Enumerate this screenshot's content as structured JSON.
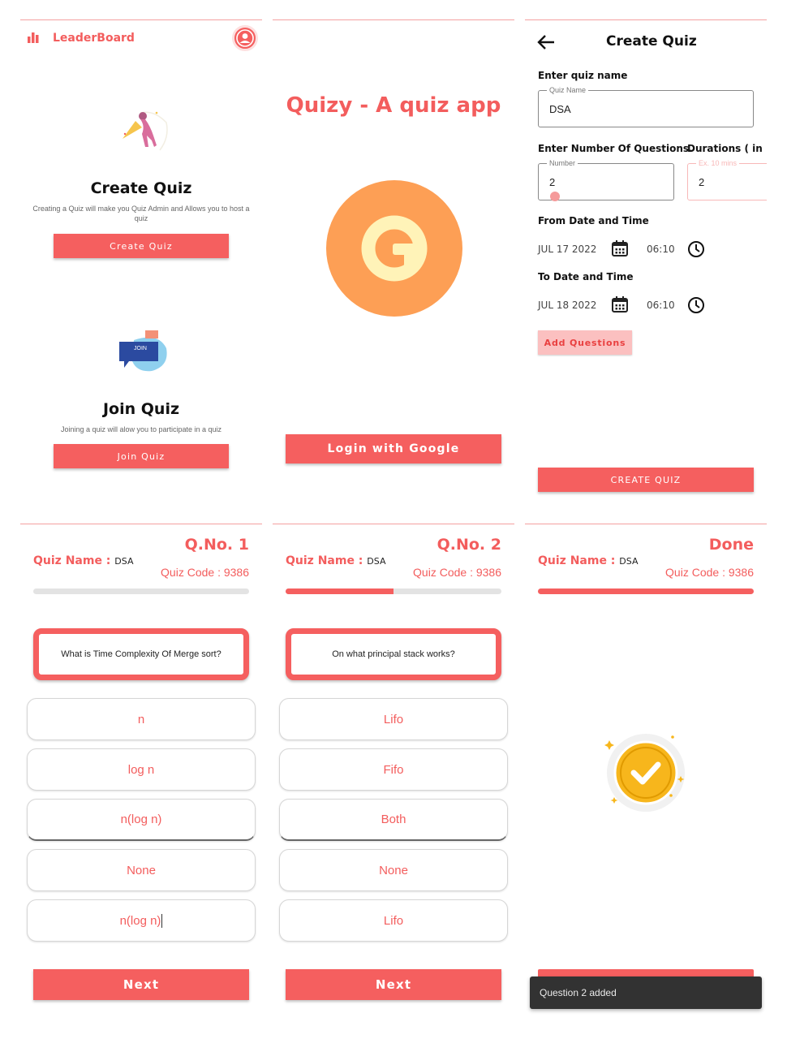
{
  "colors": {
    "accent": "#f55f5f",
    "logo": "#fd9f55",
    "logo_g": "#fff3b8",
    "done": "#f7b61c"
  },
  "home": {
    "leaderboard_label": "LeaderBoard",
    "create_title": "Create Quiz",
    "create_desc": "Creating a Quiz will make you Quiz Admin and Allows you to host a quiz",
    "create_button": "Create Quiz",
    "join_badge": "JOIN",
    "join_title": "Join Quiz",
    "join_desc": "Joining a quiz will alow you to participate in a quiz",
    "join_button": "Join Quiz"
  },
  "login": {
    "app_title": "Quizy - A quiz app",
    "google_button": "Login with Google"
  },
  "create": {
    "title": "Create Quiz",
    "name_label": "Enter quiz name",
    "name_legend": "Quiz Name",
    "name_value": "DSA",
    "num_label": "Enter Number Of Questions.",
    "num_legend": "Number",
    "num_value": "2",
    "dur_label": "Durations ( in mi",
    "dur_legend": "Ex. 10 mins",
    "dur_value": "2",
    "from_label": "From Date and Time",
    "from_date": "JUL 17 2022",
    "from_time": "06:10",
    "to_label": "To Date and Time",
    "to_date": "JUL 18 2022",
    "to_time": "06:10",
    "add_questions": "Add Questions",
    "create_button": "CREATE QUIZ"
  },
  "quiz1": {
    "qno": "Q.No. 1",
    "name_label": "Quiz Name : ",
    "name_value": "DSA",
    "code": "Quiz Code : 9386",
    "progress": 0,
    "question": "What is Time Complexity Of Merge sort?",
    "options": [
      "n",
      "log n",
      "n(log n)",
      "None",
      "n(log n)"
    ],
    "next": "Next"
  },
  "quiz2": {
    "qno": "Q.No. 2",
    "name_label": "Quiz Name : ",
    "name_value": "DSA",
    "code": "Quiz Code : 9386",
    "progress": 0.5,
    "question": "On what principal stack works?",
    "options": [
      "Lifo",
      "Fifo",
      "Both",
      "None",
      "Lifo"
    ],
    "next": "Next"
  },
  "done": {
    "title": "Done",
    "name_label": "Quiz Name : ",
    "name_value": "DSA",
    "code": "Quiz Code : 9386",
    "progress": 1,
    "toast": "Question 2 added"
  }
}
